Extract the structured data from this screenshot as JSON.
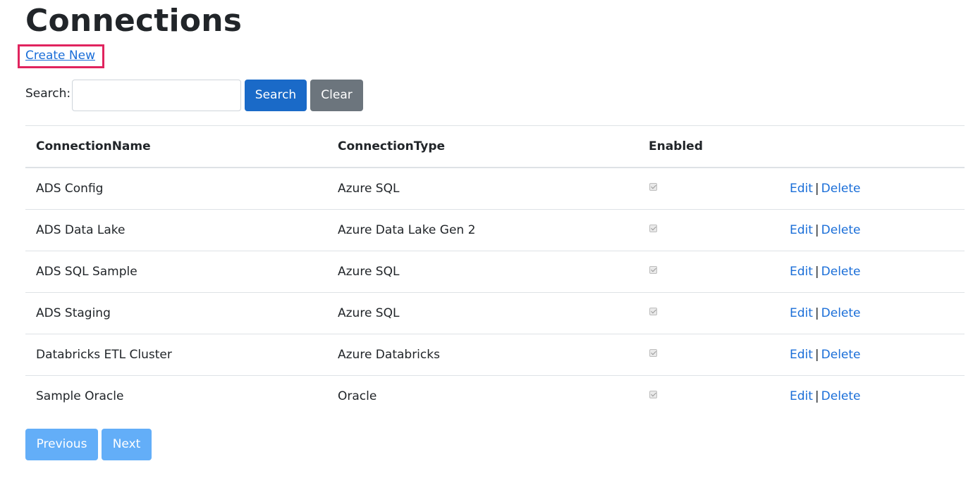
{
  "page": {
    "title": "Connections",
    "create_new_label": "Create New"
  },
  "search": {
    "label": "Search:",
    "value": "",
    "placeholder": "",
    "search_button": "Search",
    "clear_button": "Clear"
  },
  "table": {
    "headers": [
      "ConnectionName",
      "ConnectionType",
      "Enabled",
      ""
    ],
    "rows": [
      {
        "name": "ADS Config",
        "type": "Azure SQL",
        "enabled": true
      },
      {
        "name": "ADS Data Lake",
        "type": "Azure Data Lake Gen 2",
        "enabled": true
      },
      {
        "name": "ADS SQL Sample",
        "type": "Azure SQL",
        "enabled": true
      },
      {
        "name": "ADS Staging",
        "type": "Azure SQL",
        "enabled": true
      },
      {
        "name": "Databricks ETL Cluster",
        "type": "Azure Databricks",
        "enabled": true
      },
      {
        "name": "Sample Oracle",
        "type": "Oracle",
        "enabled": true
      }
    ],
    "edit_label": "Edit",
    "separator": "|",
    "delete_label": "Delete"
  },
  "pagination": {
    "previous_label": "Previous",
    "next_label": "Next"
  },
  "colors": {
    "link": "#1a6ed8",
    "primary_button": "#1a6ac8",
    "secondary_button": "#6c757d",
    "pagination_button": "#63aef8",
    "highlight_box": "#e0245e"
  }
}
